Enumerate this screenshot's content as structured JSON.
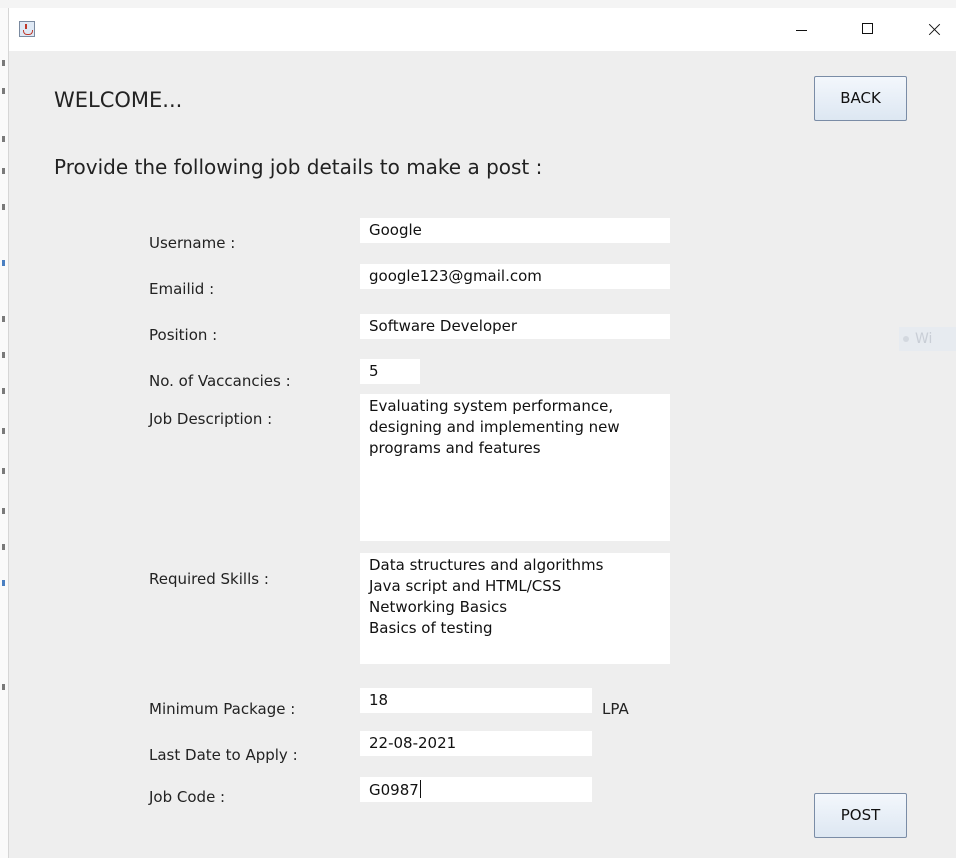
{
  "window": {
    "app_icon": "java-cup-icon",
    "controls": [
      "minimize-icon",
      "maximize-icon",
      "close-icon"
    ]
  },
  "header": {
    "welcome": "WELCOME...",
    "subtitle": "Provide the following job details to make a post :",
    "back_label": "BACK"
  },
  "form": {
    "username_label": "Username :",
    "username_value": "Google",
    "email_label": "Emailid :",
    "email_value": "google123@gmail.com",
    "position_label": "Position :",
    "position_value": "Software Developer",
    "vacancies_label": "No. of Vaccancies :",
    "vacancies_value": "5",
    "description_label": "Job Description :",
    "description_value": "Evaluating system performance,\ndesigning and implementing new\nprograms and features",
    "skills_label": "Required Skills :",
    "skills_value": "Data structures and algorithms\nJava script and HTML/CSS\nNetworking Basics\nBasics of testing",
    "package_label": "Minimum Package :",
    "package_value": "18",
    "package_unit": "LPA",
    "last_date_label": "Last Date to Apply :",
    "last_date_value": "22-08-2021",
    "job_code_label": "Job Code :",
    "job_code_value": "G0987"
  },
  "actions": {
    "post_label": "POST"
  },
  "background": {
    "ghost_text": "Wi"
  }
}
